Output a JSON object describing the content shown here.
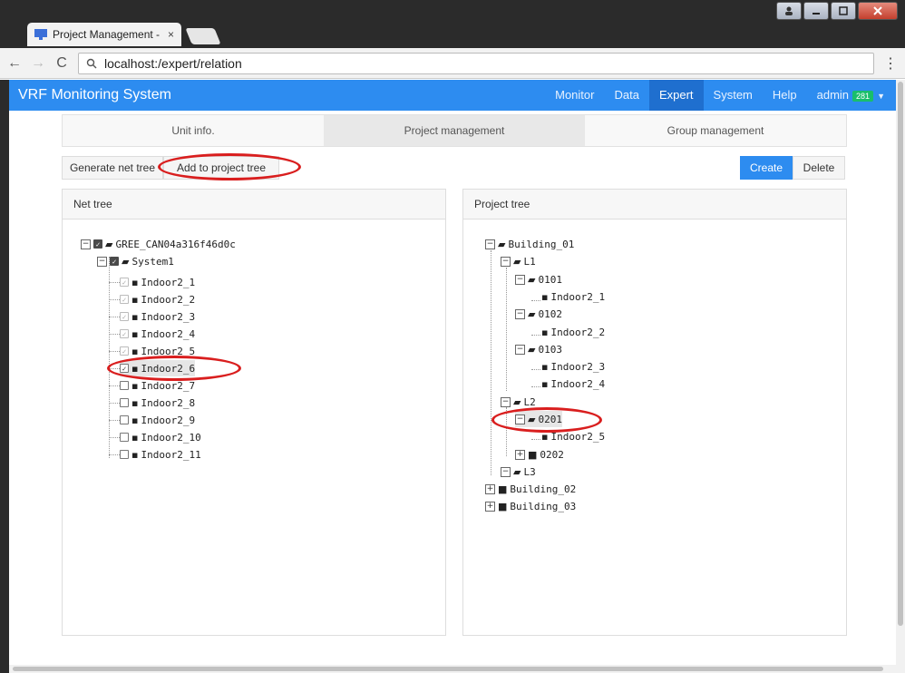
{
  "browser": {
    "tab_title": "Project Management -",
    "tab_close": "×",
    "url": "localhost:/expert/relation",
    "back_glyph": "←",
    "forward_glyph": "→",
    "reload_glyph": "C",
    "menu_glyph": "⋮"
  },
  "navbar": {
    "brand": "VRF Monitoring System",
    "items": [
      "Monitor",
      "Data",
      "Expert",
      "System",
      "Help"
    ],
    "active": "Expert",
    "user": "admin",
    "badge": "281"
  },
  "subtabs": [
    "Unit info.",
    "Project management",
    "Group management"
  ],
  "toolbar": {
    "generate": "Generate net tree",
    "add": "Add to project tree",
    "create": "Create",
    "delete": "Delete"
  },
  "net_tree": {
    "title": "Net tree",
    "root": "GREE_CAN04a316f46d0c",
    "system": "System1",
    "items": [
      "Indoor2_1",
      "Indoor2_2",
      "Indoor2_3",
      "Indoor2_4",
      "Indoor2_5",
      "Indoor2_6",
      "Indoor2_7",
      "Indoor2_8",
      "Indoor2_9",
      "Indoor2_10",
      "Indoor2_11"
    ]
  },
  "project_tree": {
    "title": "Project tree",
    "building1": "Building_01",
    "l1": "L1",
    "g0101": "0101",
    "i1": "Indoor2_1",
    "g0102": "0102",
    "i2": "Indoor2_2",
    "g0103": "0103",
    "i3": "Indoor2_3",
    "i4": "Indoor2_4",
    "l2": "L2",
    "g0201": "0201",
    "i5": "Indoor2_5",
    "g0202": "0202",
    "l3": "L3",
    "building2": "Building_02",
    "building3": "Building_03"
  },
  "colors": {
    "navbar": "#2d8cf0",
    "annotation": "#d91e1e",
    "badge": "#19be6b"
  }
}
